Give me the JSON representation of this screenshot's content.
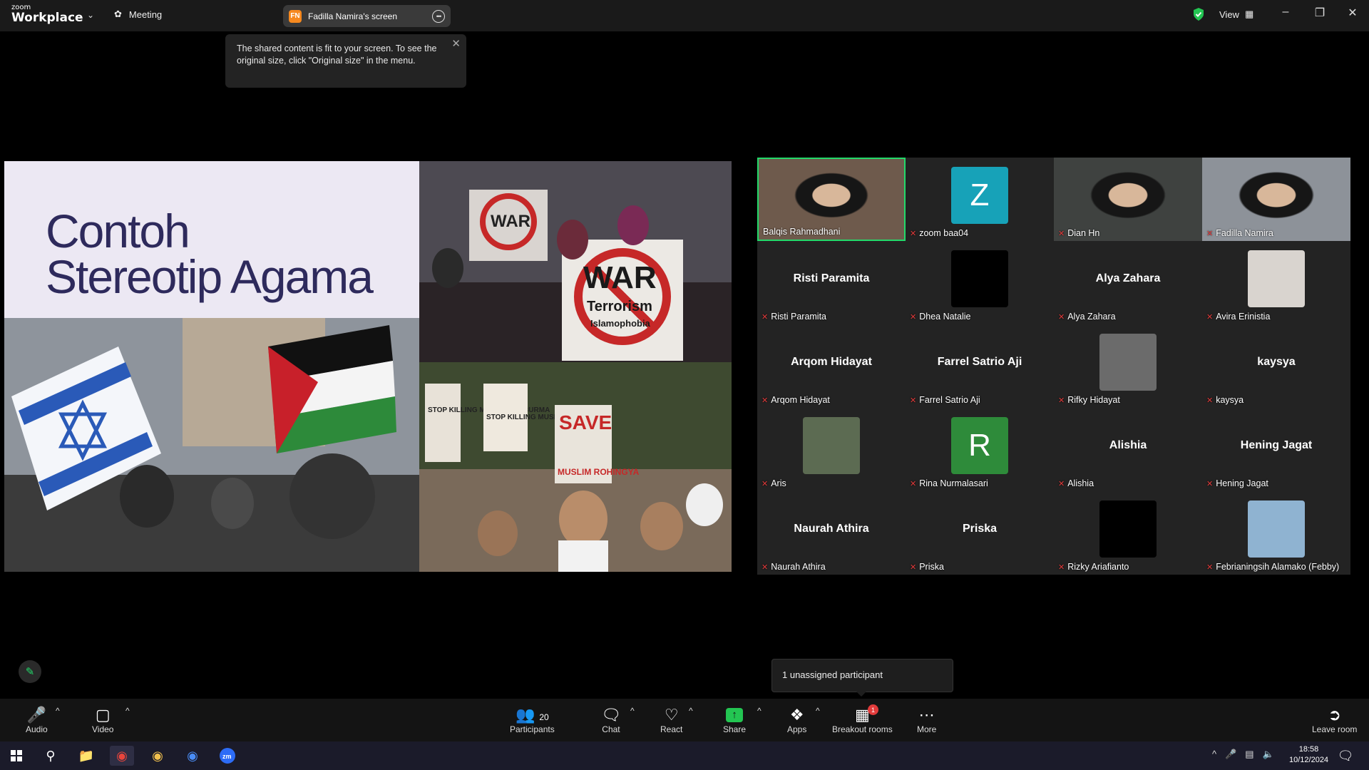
{
  "app": {
    "logo_small": "zoom",
    "logo_big": "Workplace",
    "meeting_label": "Meeting",
    "share_badge": "FN",
    "share_label": "Fadilla Namira's screen",
    "view_label": "View",
    "colors": {
      "accent": "#23d96a",
      "danger": "#e23b3b",
      "share": "#23c552",
      "badge_orange": "#f6891f"
    }
  },
  "tooltip": {
    "text": "The shared content is fit to your screen. To see the original size, click \"Original size\" in the menu."
  },
  "slide": {
    "title_line1": "Contoh",
    "title_line2": "Stereotip Agama",
    "photo1": {
      "sign1": "WAR",
      "sign2": "Terrorism",
      "sign3": "Islamophobia"
    },
    "photo3": {
      "sign1": "STOP KILLING MUSLIMS IN BURMA",
      "sign2": "SAVE",
      "sign3": "MUSLIM ROHINGYA"
    }
  },
  "participants": [
    {
      "name": "Balqis Rahmadhani",
      "kind": "video",
      "active": true,
      "bg": "#6e5a4c"
    },
    {
      "name": "zoom baa04",
      "kind": "avatar",
      "letter": "Z",
      "color": "#17a2b8"
    },
    {
      "name": "Dian Hn",
      "kind": "video",
      "bg": "#3f4240"
    },
    {
      "name": "Fadilla Namira",
      "kind": "video",
      "bg": "#8d9299"
    },
    {
      "name": "Risti Paramita",
      "kind": "name"
    },
    {
      "name": "Dhea Natalie",
      "kind": "avatar",
      "letter": "",
      "color": "#000000"
    },
    {
      "name": "Alya Zahara",
      "kind": "name"
    },
    {
      "name": "Avira Erinistia",
      "kind": "avatar",
      "letter": "",
      "color": "#d9d4cf"
    },
    {
      "name": "Arqom Hidayat",
      "kind": "name"
    },
    {
      "name": "Farrel Satrio Aji",
      "kind": "name"
    },
    {
      "name": "Rifky Hidayat",
      "kind": "avatar",
      "letter": "",
      "color": "#6b6b6b"
    },
    {
      "name": "kaysya",
      "kind": "name"
    },
    {
      "name": "Aris",
      "kind": "avatar",
      "letter": "",
      "color": "#5c6b52"
    },
    {
      "name": "Rina Nurmalasari",
      "kind": "avatar",
      "letter": "R",
      "color": "#2e8b3a"
    },
    {
      "name": "Alishia",
      "kind": "name"
    },
    {
      "name": "Hening Jagat",
      "kind": "name"
    },
    {
      "name": "Naurah Athira",
      "kind": "name"
    },
    {
      "name": "Priska",
      "kind": "name"
    },
    {
      "name": "Rizky Ariafianto",
      "kind": "avatar",
      "letter": "",
      "color": "#000000"
    },
    {
      "name": "Febrianingsih Alamako (Febby)",
      "kind": "avatar",
      "letter": "",
      "color": "#8fb3d1"
    }
  ],
  "breakout_popup": "1 unassigned participant",
  "toolbar": {
    "audio": "Audio",
    "video": "Video",
    "participants": "Participants",
    "participants_count": "20",
    "chat": "Chat",
    "react": "React",
    "share": "Share",
    "apps": "Apps",
    "breakout": "Breakout rooms",
    "breakout_badge": "1",
    "more": "More",
    "leave": "Leave room"
  },
  "taskbar": {
    "time": "18:58",
    "date": "10/12/2024"
  }
}
